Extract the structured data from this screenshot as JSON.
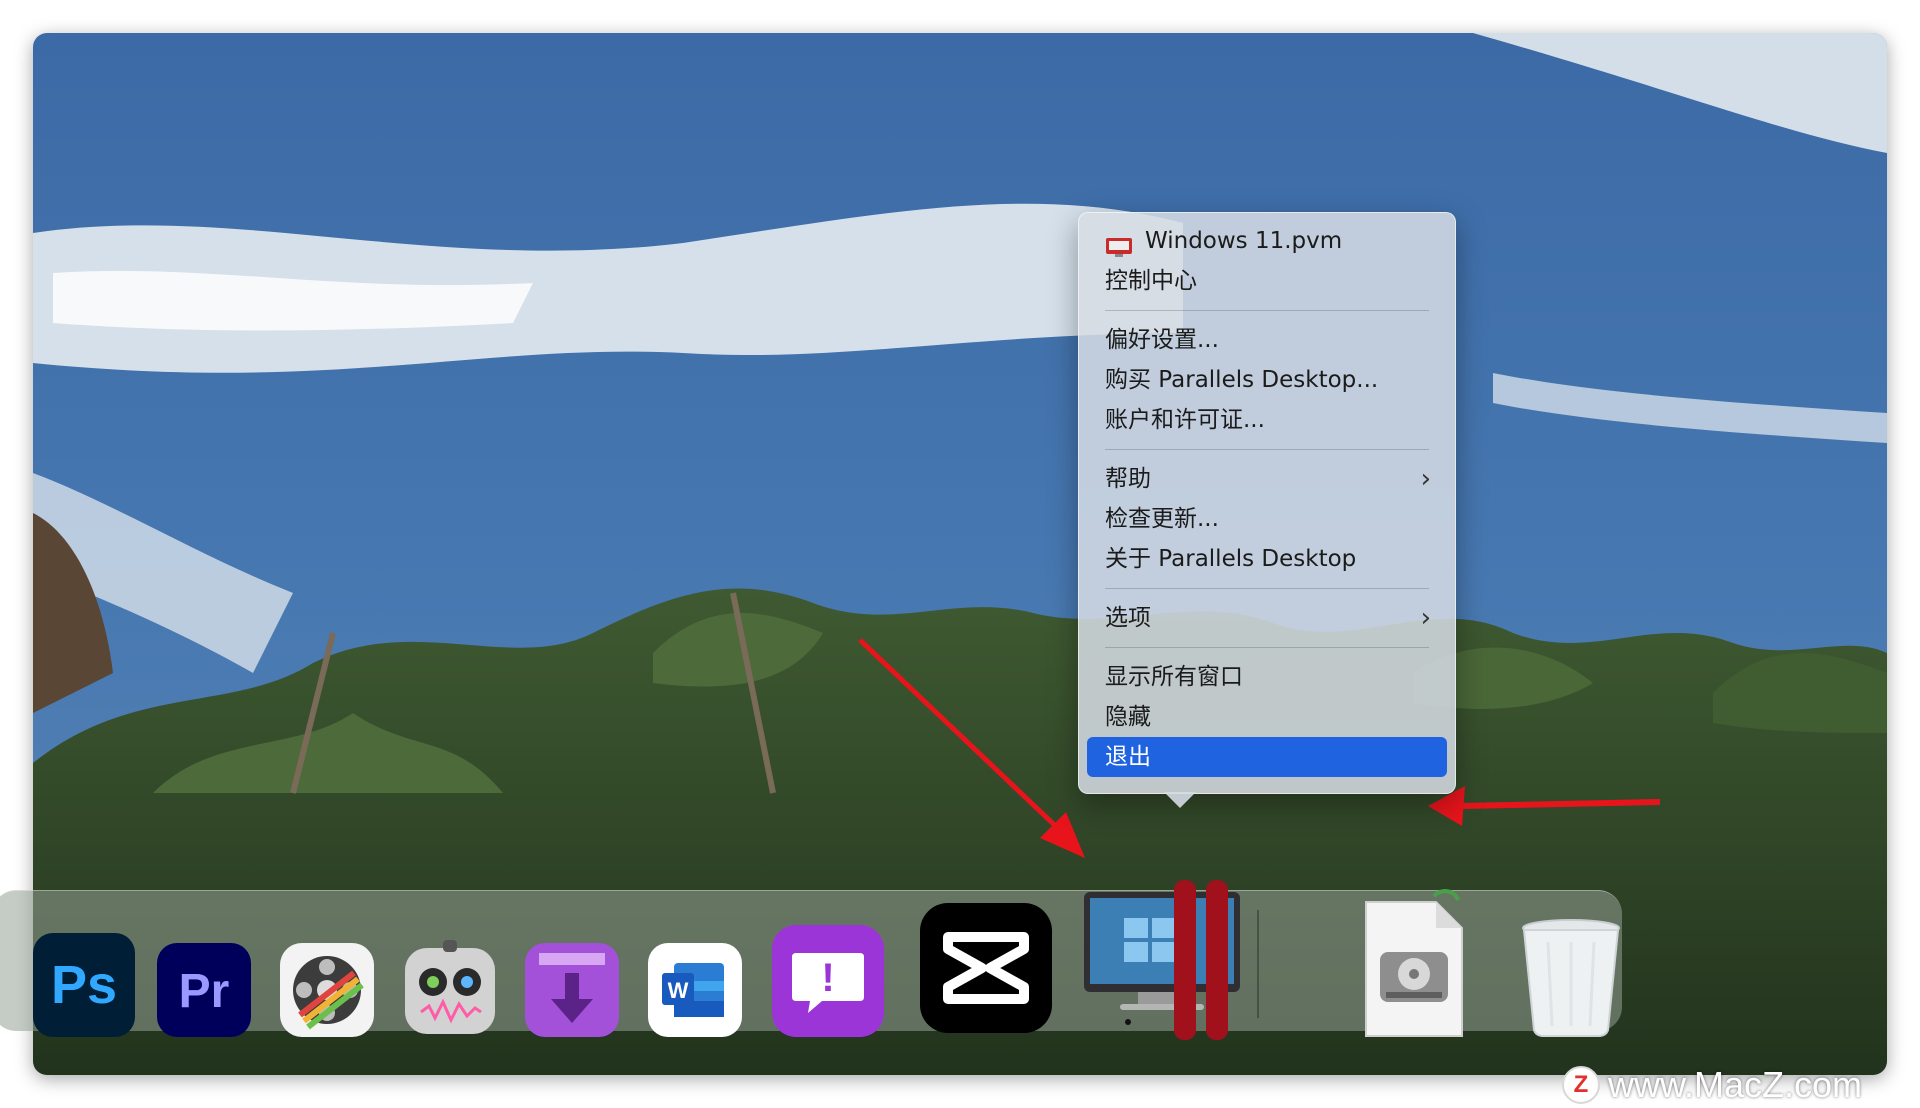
{
  "menu": {
    "items": [
      {
        "label": "Windows 11.pvm",
        "icon": "parallels-vm-icon"
      },
      {
        "label": "控制中心"
      },
      {
        "label": "偏好设置..."
      },
      {
        "label": "购买 Parallels Desktop..."
      },
      {
        "label": "账户和许可证..."
      },
      {
        "label": "帮助",
        "submenu": true
      },
      {
        "label": "检查更新..."
      },
      {
        "label": "关于 Parallels Desktop"
      },
      {
        "label": "选项",
        "submenu": true
      },
      {
        "label": "显示所有窗口"
      },
      {
        "label": "隐藏"
      },
      {
        "label": "退出",
        "highlighted": true
      }
    ],
    "highlight_color": "#1f63e0"
  },
  "dock": {
    "apps": [
      {
        "name": "Adobe Photoshop",
        "label": "Ps",
        "icon": "photoshop-icon"
      },
      {
        "name": "Adobe Premiere Pro",
        "label": "Pr",
        "icon": "premiere-icon"
      },
      {
        "name": "Video editor",
        "icon": "film-reel-icon"
      },
      {
        "name": "Audio recorder",
        "icon": "robot-audio-icon"
      },
      {
        "name": "Downloader",
        "icon": "purple-download-icon"
      },
      {
        "name": "Microsoft Word",
        "label": "W",
        "icon": "word-icon"
      },
      {
        "name": "Feedback",
        "label": "!",
        "icon": "feedback-icon"
      },
      {
        "name": "CapCut",
        "icon": "capcut-icon"
      },
      {
        "name": "Parallels Desktop",
        "icon": "parallels-icon"
      },
      {
        "name": "Disk image",
        "icon": "disk-image-icon"
      },
      {
        "name": "Trash",
        "icon": "trash-icon"
      }
    ]
  },
  "watermark": {
    "logo_letter": "Z",
    "text": "www.MacZ.com"
  },
  "annotations": {
    "arrow_color": "#e8141c"
  }
}
